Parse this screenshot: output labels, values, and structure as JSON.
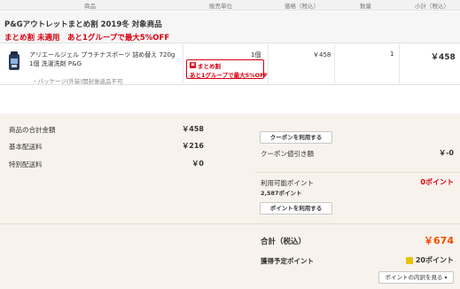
{
  "headers": {
    "product": "商品",
    "unit": "販売単位",
    "price": "価格（税込）",
    "quantity": "数量",
    "subtotal": "小計（税込）"
  },
  "group": {
    "title": "P&Gアウトレットまとめ割 2019冬 対象商品",
    "promo": "まとめ割 未適用　あと1グループで最大5%OFF"
  },
  "item": {
    "name": "アリエールジェル プラチナスポーツ 詰め替え 720g 1個 洗濯洗剤 P&G",
    "note": "・パッケージ(外装)開封後返品不可",
    "unit": "1個",
    "badge_title": "まとめ割",
    "badge_text": "あと1グループで最大5%OFF",
    "price": "￥458",
    "quantity": "1",
    "subtotal": "￥458"
  },
  "summary": {
    "goods_total_label": "商品の合計金額",
    "goods_total": "￥458",
    "shipping_label": "基本配送料",
    "shipping": "￥216",
    "special_shipping_label": "特別配送料",
    "special_shipping": "￥0",
    "coupon_button": "クーポンを利用する",
    "coupon_discount_label": "クーポン値引き額",
    "coupon_discount": "￥-0",
    "usable_points_label": "利用可能ポイント",
    "usable_points": "0ポイント",
    "owned_points": "2,587ポイント",
    "points_button": "ポイントを利用する",
    "total_label": "合計（税込）",
    "total": "￥674",
    "earn_points_label": "獲得予定ポイント",
    "earn_points": "20ポイント",
    "points_detail_button": "ポイントの内訳を見る"
  },
  "colors": {
    "accent_red": "#d7000f",
    "total_orange": "#f24c00",
    "summary_bg": "#f7f2ec"
  }
}
